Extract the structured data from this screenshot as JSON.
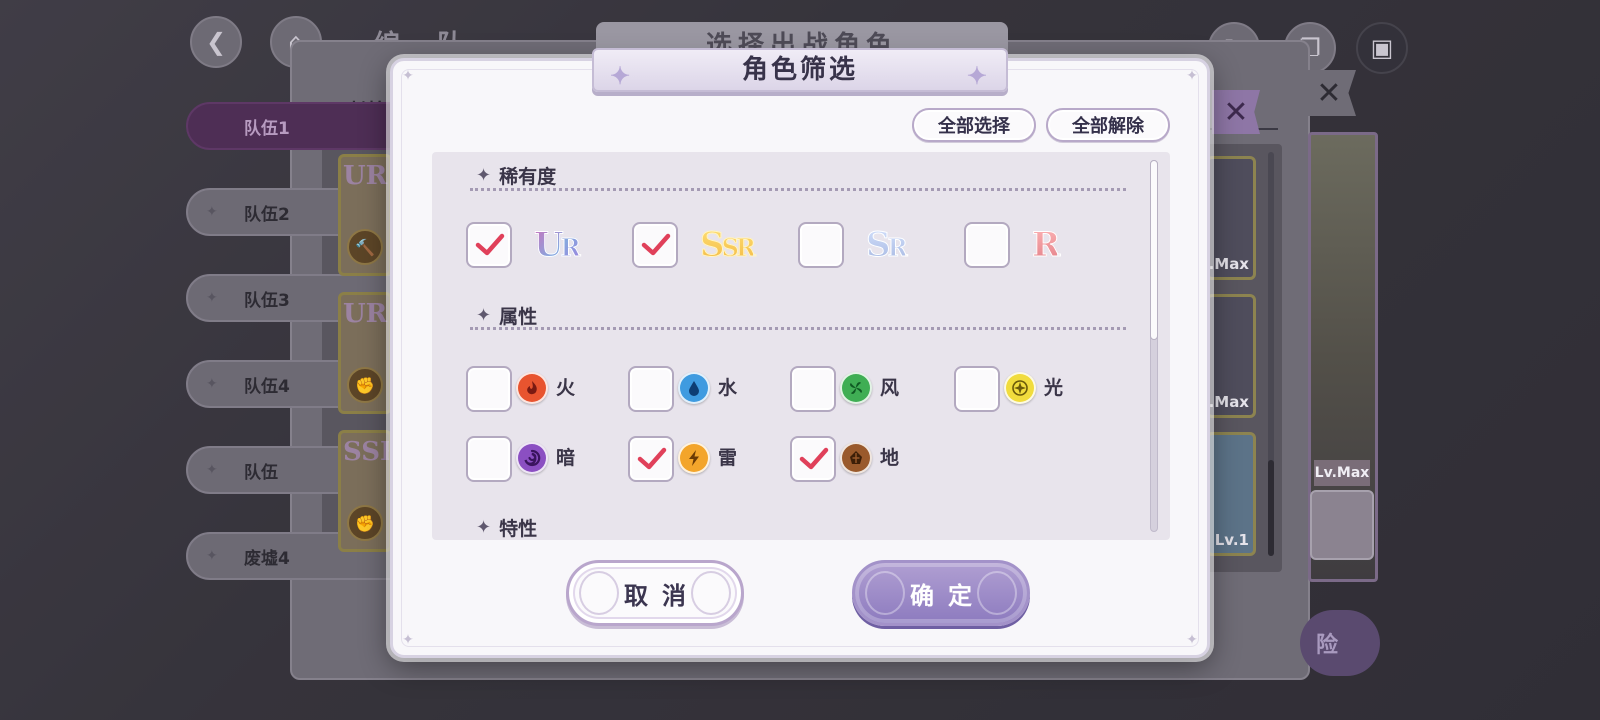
{
  "background": {
    "title": "编 队",
    "panel_title": "选择出战角色",
    "hint": "长按",
    "teams": [
      "队伍1",
      "队伍2",
      "队伍3",
      "队伍4",
      "队伍",
      "废墟4"
    ],
    "card_rarities": [
      "UR",
      "UR",
      "SSR"
    ],
    "card_icons": [
      "🔨",
      "✊",
      "✊"
    ],
    "right_levels": [
      ".Max",
      ".Max",
      "Lv.1"
    ],
    "art_level": "Lv.Max",
    "explore_label": "险",
    "close_glyph": "✕",
    "back_glyph": "❮"
  },
  "modal": {
    "title": "角色筛选",
    "select_all": "全部选择",
    "deselect_all": "全部解除",
    "rarity": {
      "heading": "稀有度",
      "options": [
        {
          "label_main": "U",
          "label_sub": "R",
          "checked": true
        },
        {
          "label_main": "S",
          "label_sub": "SR",
          "checked": true
        },
        {
          "label_main": "S",
          "label_sub": "R",
          "checked": false
        },
        {
          "label_main": "R",
          "label_sub": "",
          "checked": false
        }
      ]
    },
    "attribute": {
      "heading": "属性",
      "options": [
        {
          "name": "火",
          "icon": "fire-icon",
          "color": "#e8542f",
          "checked": false
        },
        {
          "name": "水",
          "icon": "water-icon",
          "color": "#3f9be0",
          "checked": false
        },
        {
          "name": "风",
          "icon": "wind-icon",
          "color": "#3fae54",
          "checked": false
        },
        {
          "name": "光",
          "icon": "light-icon",
          "color": "#f1dc3d",
          "checked": false
        },
        {
          "name": "暗",
          "icon": "dark-icon",
          "color": "#8b4fc2",
          "checked": false
        },
        {
          "name": "雷",
          "icon": "thunder-icon",
          "color": "#f3a52b",
          "checked": true
        },
        {
          "name": "地",
          "icon": "earth-icon",
          "color": "#9a5a2c",
          "checked": true
        }
      ]
    },
    "trait": {
      "heading": "特性"
    },
    "cancel": "取消",
    "confirm": "确定"
  },
  "colors": {
    "accent": "#8d7bbf",
    "check": "#e0405a",
    "panel": "#e8e4ec"
  }
}
